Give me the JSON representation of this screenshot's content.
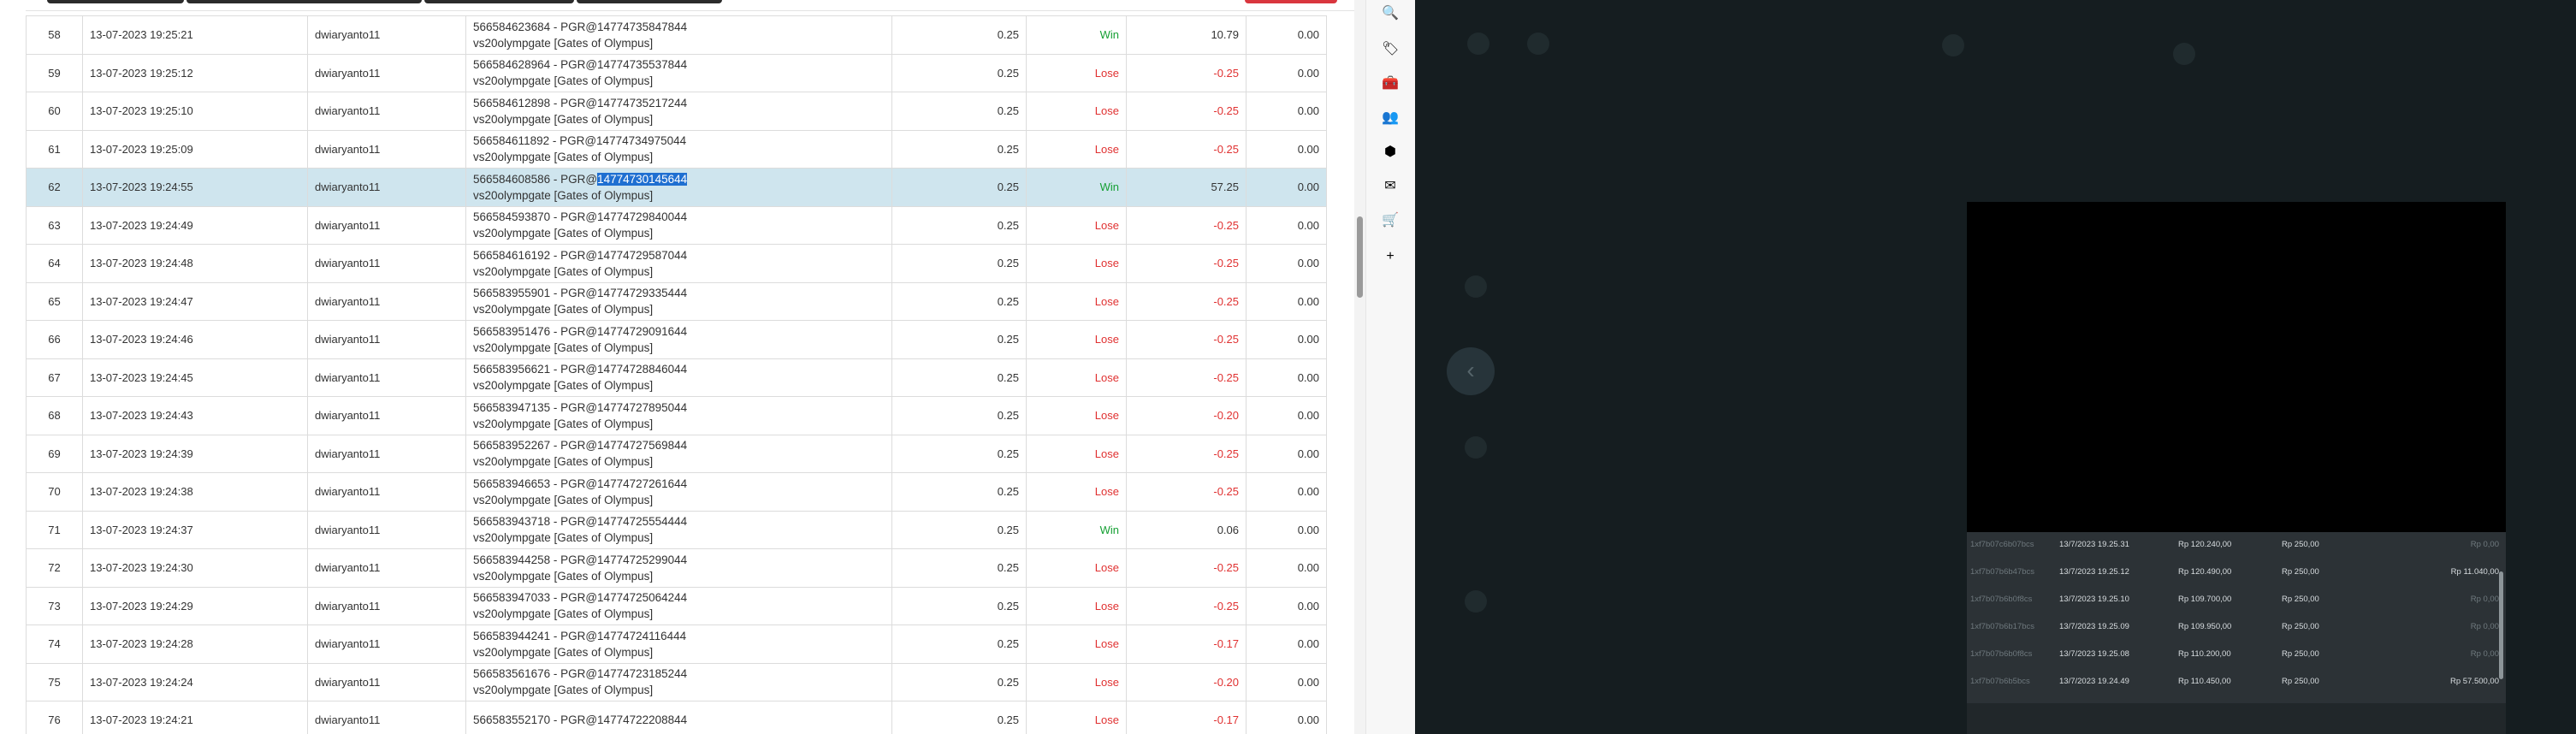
{
  "table": {
    "rows": [
      {
        "no": "58",
        "date": "13-07-2023 19:25:21",
        "user": "dwiaryanto11",
        "desc1": "566584623684 - PGR@14774735847844",
        "desc2": "vs20olympgate [Gates of Olympus]",
        "bet": "0.25",
        "result": "Win",
        "winloss": "10.79",
        "jp": "0.00"
      },
      {
        "no": "59",
        "date": "13-07-2023 19:25:12",
        "user": "dwiaryanto11",
        "desc1": "566584628964 - PGR@14774735537844",
        "desc2": "vs20olympgate [Gates of Olympus]",
        "bet": "0.25",
        "result": "Lose",
        "winloss": "-0.25",
        "jp": "0.00"
      },
      {
        "no": "60",
        "date": "13-07-2023 19:25:10",
        "user": "dwiaryanto11",
        "desc1": "566584612898 - PGR@14774735217244",
        "desc2": "vs20olympgate [Gates of Olympus]",
        "bet": "0.25",
        "result": "Lose",
        "winloss": "-0.25",
        "jp": "0.00"
      },
      {
        "no": "61",
        "date": "13-07-2023 19:25:09",
        "user": "dwiaryanto11",
        "desc1": "566584611892 - PGR@14774734975044",
        "desc2": "vs20olympgate [Gates of Olympus]",
        "bet": "0.25",
        "result": "Lose",
        "winloss": "-0.25",
        "jp": "0.00"
      },
      {
        "no": "62",
        "date": "13-07-2023 19:24:55",
        "user": "dwiaryanto11",
        "desc1_pre": "566584608586 - PGR@",
        "desc1_sel": "14774730145644",
        "desc2": "vs20olympgate [Gates of Olympus]",
        "bet": "0.25",
        "result": "Win",
        "winloss": "57.25",
        "jp": "0.00"
      },
      {
        "no": "63",
        "date": "13-07-2023 19:24:49",
        "user": "dwiaryanto11",
        "desc1": "566584593870 - PGR@14774729840044",
        "desc2": "vs20olympgate [Gates of Olympus]",
        "bet": "0.25",
        "result": "Lose",
        "winloss": "-0.25",
        "jp": "0.00"
      },
      {
        "no": "64",
        "date": "13-07-2023 19:24:48",
        "user": "dwiaryanto11",
        "desc1": "566584616192 - PGR@14774729587044",
        "desc2": "vs20olympgate [Gates of Olympus]",
        "bet": "0.25",
        "result": "Lose",
        "winloss": "-0.25",
        "jp": "0.00"
      },
      {
        "no": "65",
        "date": "13-07-2023 19:24:47",
        "user": "dwiaryanto11",
        "desc1": "566583955901 - PGR@14774729335444",
        "desc2": "vs20olympgate [Gates of Olympus]",
        "bet": "0.25",
        "result": "Lose",
        "winloss": "-0.25",
        "jp": "0.00"
      },
      {
        "no": "66",
        "date": "13-07-2023 19:24:46",
        "user": "dwiaryanto11",
        "desc1": "566583951476 - PGR@14774729091644",
        "desc2": "vs20olympgate [Gates of Olympus]",
        "bet": "0.25",
        "result": "Lose",
        "winloss": "-0.25",
        "jp": "0.00"
      },
      {
        "no": "67",
        "date": "13-07-2023 19:24:45",
        "user": "dwiaryanto11",
        "desc1": "566583956621 - PGR@14774728846044",
        "desc2": "vs20olympgate [Gates of Olympus]",
        "bet": "0.25",
        "result": "Lose",
        "winloss": "-0.25",
        "jp": "0.00"
      },
      {
        "no": "68",
        "date": "13-07-2023 19:24:43",
        "user": "dwiaryanto11",
        "desc1": "566583947135 - PGR@14774727895044",
        "desc2": "vs20olympgate [Gates of Olympus]",
        "bet": "0.25",
        "result": "Lose",
        "winloss": "-0.20",
        "jp": "0.00"
      },
      {
        "no": "69",
        "date": "13-07-2023 19:24:39",
        "user": "dwiaryanto11",
        "desc1": "566583952267 - PGR@14774727569844",
        "desc2": "vs20olympgate [Gates of Olympus]",
        "bet": "0.25",
        "result": "Lose",
        "winloss": "-0.25",
        "jp": "0.00"
      },
      {
        "no": "70",
        "date": "13-07-2023 19:24:38",
        "user": "dwiaryanto11",
        "desc1": "566583946653 - PGR@14774727261644",
        "desc2": "vs20olympgate [Gates of Olympus]",
        "bet": "0.25",
        "result": "Lose",
        "winloss": "-0.25",
        "jp": "0.00"
      },
      {
        "no": "71",
        "date": "13-07-2023 19:24:37",
        "user": "dwiaryanto11",
        "desc1": "566583943718 - PGR@14774725554444",
        "desc2": "vs20olympgate [Gates of Olympus]",
        "bet": "0.25",
        "result": "Win",
        "winloss": "0.06",
        "jp": "0.00"
      },
      {
        "no": "72",
        "date": "13-07-2023 19:24:30",
        "user": "dwiaryanto11",
        "desc1": "566583944258 - PGR@14774725299044",
        "desc2": "vs20olympgate [Gates of Olympus]",
        "bet": "0.25",
        "result": "Lose",
        "winloss": "-0.25",
        "jp": "0.00"
      },
      {
        "no": "73",
        "date": "13-07-2023 19:24:29",
        "user": "dwiaryanto11",
        "desc1": "566583947033 - PGR@14774725064244",
        "desc2": "vs20olympgate [Gates of Olympus]",
        "bet": "0.25",
        "result": "Lose",
        "winloss": "-0.25",
        "jp": "0.00"
      },
      {
        "no": "74",
        "date": "13-07-2023 19:24:28",
        "user": "dwiaryanto11",
        "desc1": "566583944241 - PGR@14774724116444",
        "desc2": "vs20olympgate [Gates of Olympus]",
        "bet": "0.25",
        "result": "Lose",
        "winloss": "-0.17",
        "jp": "0.00"
      },
      {
        "no": "75",
        "date": "13-07-2023 19:24:24",
        "user": "dwiaryanto11",
        "desc1": "566583561676 - PGR@14774723185244",
        "desc2": "vs20olympgate [Gates of Olympus]",
        "bet": "0.25",
        "result": "Lose",
        "winloss": "-0.20",
        "jp": "0.00"
      },
      {
        "no": "76",
        "date": "13-07-2023 19:24:21",
        "user": "dwiaryanto11",
        "desc1": "566583552170 - PGR@14774722208844",
        "desc2": "",
        "bet": "0.25",
        "result": "Lose",
        "winloss": "-0.17",
        "jp": "0.00"
      }
    ]
  },
  "sidebar_icons": [
    "search-icon",
    "tag-icon",
    "toolbox-icon",
    "people-icon",
    "office-icon",
    "outlook-icon",
    "shopping-cart-icon",
    "plus-icon"
  ],
  "sidebar_glyphs": [
    "🔍",
    "🏷",
    "🧰",
    "👥",
    "⬢",
    "✉",
    "🛒",
    "+"
  ],
  "right": {
    "back_glyph": "‹",
    "history": [
      {
        "id": "1xf7b07c6b07bcs",
        "time": "13/7/2023 19.25.31",
        "balance": "Rp 120.240,00",
        "bet": "Rp 250,00",
        "win": "Rp 0,00",
        "win_dim": true
      },
      {
        "id": "1xf7b07b6b47bcs",
        "time": "13/7/2023 19.25.12",
        "balance": "Rp 120.490,00",
        "bet": "Rp 250,00",
        "win": "Rp 11.040,00",
        "win_dim": false
      },
      {
        "id": "1xf7b07b6b0f8cs",
        "time": "13/7/2023 19.25.10",
        "balance": "Rp 109.700,00",
        "bet": "Rp 250,00",
        "win": "Rp 0,00",
        "win_dim": true
      },
      {
        "id": "1xf7b07b6b17bcs",
        "time": "13/7/2023 19.25.09",
        "balance": "Rp 109.950,00",
        "bet": "Rp 250,00",
        "win": "Rp 0,00",
        "win_dim": true
      },
      {
        "id": "1xf7b07b6b0f8cs",
        "time": "13/7/2023 19.25.08",
        "balance": "Rp 110.200,00",
        "bet": "Rp 250,00",
        "win": "Rp 0,00",
        "win_dim": true
      },
      {
        "id": "1xf7b07b6b5bcs",
        "time": "13/7/2023 19.24.49",
        "balance": "Rp 110.450,00",
        "bet": "Rp 250,00",
        "win": "Rp 57.500,00",
        "win_dim": false
      }
    ]
  },
  "colors": {
    "win": "#16a034",
    "lose": "#e03131",
    "selected_row": "#cfe5ee",
    "dark_bg": "#151d20"
  }
}
